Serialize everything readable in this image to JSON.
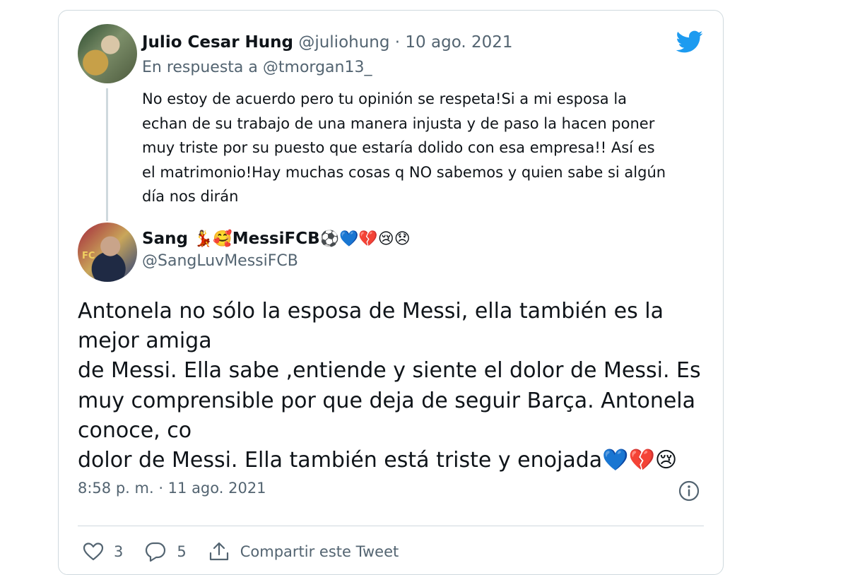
{
  "quoted_tweet": {
    "author_name": "Julio Cesar Hung",
    "author_handle": "@juliohung",
    "separator": " · ",
    "date": "10 ago. 2021",
    "reply_prefix": "En respuesta a ",
    "reply_handle": "@tmorgan13_",
    "text": "No estoy de acuerdo pero tu opinión se respeta!Si a mi esposa la\nechan de su trabajo de una manera injusta y de paso la hacen poner\nmuy triste por su puesto que estaría dolido con esa empresa!! Así es\nel matrimonio!Hay muchas cosas q NO sabemos y quien sabe si algún\ndía nos dirán"
  },
  "main_tweet": {
    "name_prefix": "Sang",
    "name_emoji_1": "💃🥰",
    "name_core": "MessiFCB",
    "name_emoji_2": "⚽💙💔😢😞",
    "author_handle": "@SangLuvMessiFCB",
    "text": "Antonela no sólo la esposa de Messi, ella también es la\nmejor amiga\nde Messi. Ella sabe ,entiende y siente el dolor de Messi. Es\nmuy comprensible por que deja de seguir Barça. Antonela\nconoce, co\ndolor de Messi. Ella también está triste y enojada💙💔😢",
    "timestamp": "8:58 p. m. · 11 ago. 2021"
  },
  "actions": {
    "like_count": "3",
    "reply_count": "5",
    "share_label": "Compartir este Tweet"
  },
  "icons": {
    "brand": "twitter-bird-icon",
    "info": "info-icon",
    "like": "heart-icon",
    "reply": "reply-bubble-icon",
    "share": "share-icon"
  },
  "colors": {
    "brand": "#1d9bf0",
    "muted_text": "#536471",
    "border": "#cfd9de",
    "text": "#0f1419"
  }
}
